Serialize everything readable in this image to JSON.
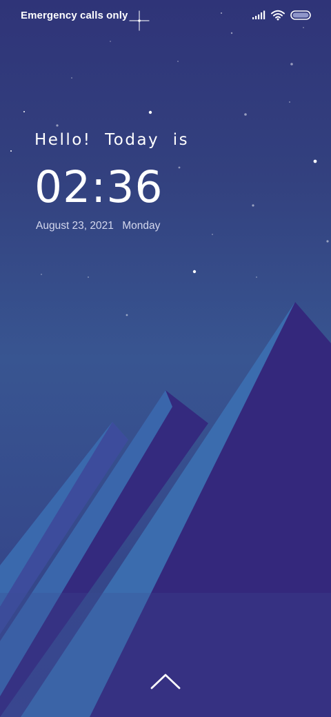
{
  "status_bar": {
    "carrier_text": "Emergency calls only",
    "icons": [
      "signal-icon",
      "wifi-icon",
      "battery-icon"
    ]
  },
  "lock_screen": {
    "greeting": "Hello!  Today  is",
    "time": "02:36",
    "date": "August 23, 2021",
    "weekday": "Monday"
  },
  "navigation": {
    "swipe_icon": "chevron-up-icon"
  },
  "colors": {
    "sky_top": "#2f3478",
    "sky_mid": "#385591",
    "mountain_dark": "#33287a",
    "mountain_light": "#3b6aac",
    "text": "#ffffff"
  }
}
